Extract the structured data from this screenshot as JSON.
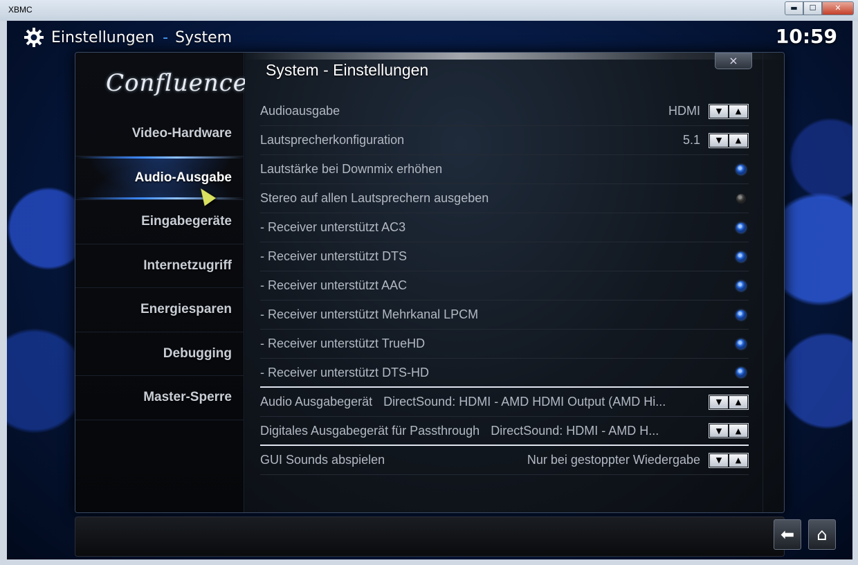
{
  "window": {
    "title": "XBMC",
    "minimize": "▬",
    "maximize": "☐",
    "close": "✕"
  },
  "header": {
    "section": "Einstellungen",
    "separator": "-",
    "subsection": "System",
    "clock": "10:59"
  },
  "sidebar": {
    "logo": "Confluence",
    "items": [
      {
        "label": "Video-Hardware"
      },
      {
        "label": "Audio-Ausgabe",
        "active": true
      },
      {
        "label": "Eingabegeräte"
      },
      {
        "label": "Internetzugriff"
      },
      {
        "label": "Energiesparen"
      },
      {
        "label": "Debugging"
      },
      {
        "label": "Master-Sperre"
      }
    ]
  },
  "dialog": {
    "title": "System - Einstellungen",
    "close": "×"
  },
  "settings": [
    {
      "label": "Audioausgabe",
      "value": "HDMI",
      "type": "spin"
    },
    {
      "label": "Lautsprecherkonfiguration",
      "value": "5.1",
      "type": "spin"
    },
    {
      "label": "Lautstärke bei Downmix erhöhen",
      "type": "radio",
      "on": true
    },
    {
      "label": "Stereo auf allen Lautsprechern ausgeben",
      "type": "radio",
      "on": false
    },
    {
      "label": "- Receiver unterstützt AC3",
      "type": "radio",
      "on": true
    },
    {
      "label": "- Receiver unterstützt DTS",
      "type": "radio",
      "on": true
    },
    {
      "label": "- Receiver unterstützt AAC",
      "type": "radio",
      "on": true
    },
    {
      "label": "- Receiver unterstützt Mehrkanal LPCM",
      "type": "radio",
      "on": true
    },
    {
      "label": "- Receiver unterstützt TrueHD",
      "type": "radio",
      "on": true
    },
    {
      "label": "- Receiver unterstützt DTS-HD",
      "type": "radio",
      "on": true
    },
    {
      "label": "Audio Ausgabegerät",
      "value": "DirectSound: HDMI - AMD HDMI Output (AMD Hi...",
      "type": "spin"
    },
    {
      "label": "Digitales Ausgabegerät für Passthrough",
      "value": "DirectSound: HDMI - AMD H...",
      "type": "spin"
    },
    {
      "label": "GUI Sounds abspielen",
      "value": "Nur bei gestoppter Wiedergabe",
      "type": "spin"
    }
  ],
  "spin": {
    "down": "▼",
    "up": "▲"
  },
  "footer": {
    "back": "⬅",
    "home": "⌂"
  },
  "colors": {
    "accent": "#3f8cff",
    "radio_on": "#2e6fe0",
    "text": "#b3b9c3"
  }
}
